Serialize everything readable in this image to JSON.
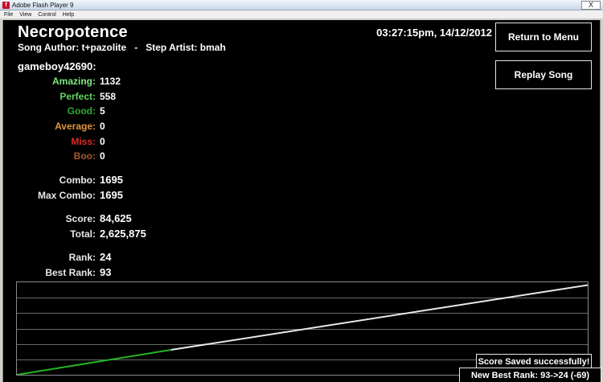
{
  "window": {
    "title": "Adobe Flash Player 9",
    "icon": "flash-icon",
    "close_glyph": "X"
  },
  "menu": [
    "File",
    "View",
    "Control",
    "Help"
  ],
  "song": {
    "title": "Necropotence",
    "info": "Song Author: t+pazolite   -   Step Artist: bmah",
    "timestamp": "03:27:15pm, 14/12/2012"
  },
  "buttons": {
    "return_label": "Return to Menu",
    "replay_label": "Replay Song"
  },
  "player": "gameboy42690:",
  "judgements": [
    {
      "label": "Amazing:",
      "value": "1132",
      "color": "#7fe87f"
    },
    {
      "label": "Perfect:",
      "value": "558",
      "color": "#5fd35f"
    },
    {
      "label": "Good:",
      "value": "5",
      "color": "#2dab2d"
    },
    {
      "label": "Average:",
      "value": "0",
      "color": "#e0963a"
    },
    {
      "label": "Miss:",
      "value": "0",
      "color": "#e02828"
    },
    {
      "label": "Boo:",
      "value": "0",
      "color": "#a35a2a"
    }
  ],
  "stats": {
    "combo_label": "Combo:",
    "combo": "1695",
    "max_combo_label": "Max Combo:",
    "max_combo": "1695",
    "score_label": "Score:",
    "score": "84,625",
    "total_label": "Total:",
    "total": "2,625,875",
    "rank_label": "Rank:",
    "rank": "24",
    "best_rank_label": "Best Rank:",
    "best_rank": "93"
  },
  "graph": {
    "series": [
      {
        "color": "#22b422",
        "points": [
          [
            0,
            0
          ],
          [
            0.27,
            0.27
          ]
        ]
      },
      {
        "color": "#e8e8e8",
        "points": [
          [
            0.27,
            0.27
          ],
          [
            1,
            0.97
          ]
        ]
      }
    ],
    "gridlines": 6
  },
  "notifications": {
    "saved": "Score Saved successfully!",
    "rank": "New Best Rank: 93->24 (-69)"
  }
}
